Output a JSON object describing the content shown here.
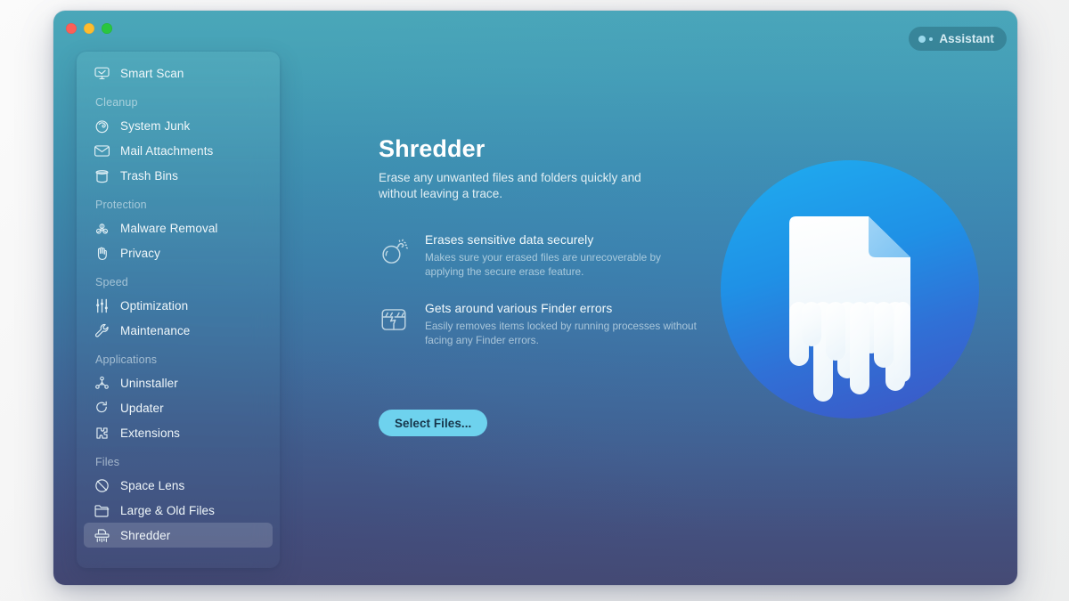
{
  "window": {
    "traffic_lights": [
      "close",
      "minimize",
      "zoom"
    ],
    "assistant": {
      "label": "Assistant",
      "icon": "assistant-dots-icon"
    }
  },
  "sidebar": {
    "groups": [
      {
        "label": "",
        "items": [
          {
            "label": "Smart Scan",
            "icon": "monitor-scan-icon",
            "selected": false
          }
        ]
      },
      {
        "label": "Cleanup",
        "items": [
          {
            "label": "System Junk",
            "icon": "broom-swirl-icon",
            "selected": false
          },
          {
            "label": "Mail Attachments",
            "icon": "envelope-icon",
            "selected": false
          },
          {
            "label": "Trash Bins",
            "icon": "trash-bin-icon",
            "selected": false
          }
        ]
      },
      {
        "label": "Protection",
        "items": [
          {
            "label": "Malware Removal",
            "icon": "biohazard-icon",
            "selected": false
          },
          {
            "label": "Privacy",
            "icon": "hand-icon",
            "selected": false
          }
        ]
      },
      {
        "label": "Speed",
        "items": [
          {
            "label": "Optimization",
            "icon": "sliders-icon",
            "selected": false
          },
          {
            "label": "Maintenance",
            "icon": "wrench-icon",
            "selected": false
          }
        ]
      },
      {
        "label": "Applications",
        "items": [
          {
            "label": "Uninstaller",
            "icon": "molecule-icon",
            "selected": false
          },
          {
            "label": "Updater",
            "icon": "refresh-arrow-icon",
            "selected": false
          },
          {
            "label": "Extensions",
            "icon": "puzzle-piece-icon",
            "selected": false
          }
        ]
      },
      {
        "label": "Files",
        "items": [
          {
            "label": "Space Lens",
            "icon": "planet-lens-icon",
            "selected": false
          },
          {
            "label": "Large & Old Files",
            "icon": "folder-icon",
            "selected": false
          },
          {
            "label": "Shredder",
            "icon": "shredder-icon",
            "selected": true
          }
        ]
      }
    ]
  },
  "main": {
    "title": "Shredder",
    "subtitle": "Erase any unwanted files and folders quickly and without leaving a trace.",
    "features": [
      {
        "icon": "bomb-icon",
        "title": "Erases sensitive data securely",
        "description": "Makes sure your erased files are unrecoverable by applying the secure erase feature."
      },
      {
        "icon": "broken-box-icon",
        "title": "Gets around various Finder errors",
        "description": "Easily removes items locked by running processes without facing any Finder errors."
      }
    ],
    "primary_button": "Select Files...",
    "hero_icon": "shredded-document-icon"
  },
  "colors": {
    "window_top": "#4aa7b9",
    "window_bottom": "#454a74",
    "accent_button": "#6ed2ee",
    "hero_circle_top": "#24a3ea",
    "hero_circle_bottom": "#3563cf",
    "selected_row": "rgba(255,255,255,0.155)"
  }
}
